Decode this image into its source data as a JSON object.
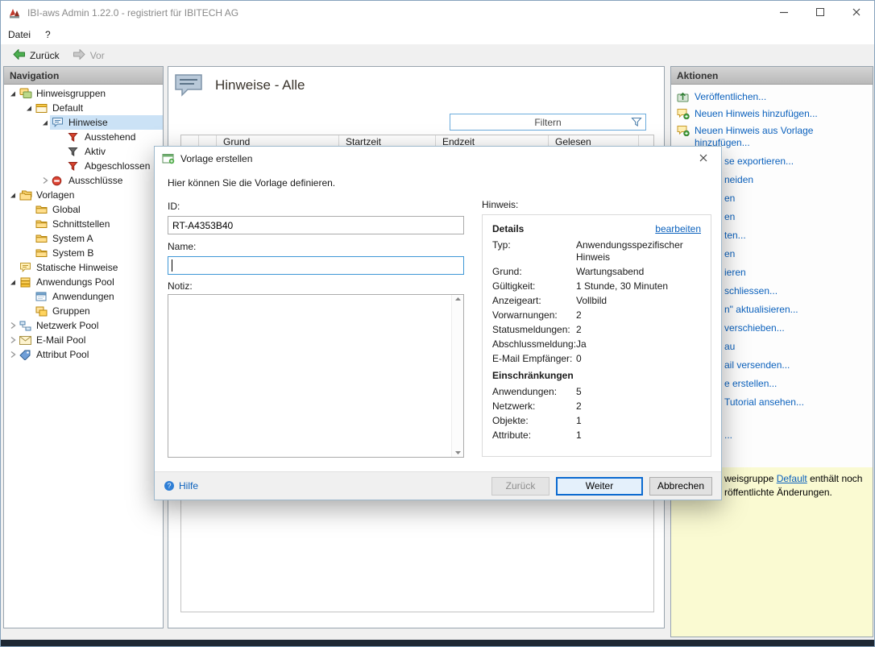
{
  "window": {
    "title": "IBI-aws Admin 1.22.0 - registriert für IBITECH AG"
  },
  "menubar": {
    "items": [
      {
        "label": "Datei"
      },
      {
        "label": "?"
      }
    ]
  },
  "toolbar": {
    "back": "Zurück",
    "forward": "Vor"
  },
  "nav": {
    "header": "Navigation",
    "items": [
      {
        "label": "Hinweisgruppen",
        "level": 0,
        "chevron": "expanded",
        "icon": "group-stack"
      },
      {
        "label": "Default",
        "level": 1,
        "chevron": "expanded",
        "icon": "hint-group"
      },
      {
        "label": "Hinweise",
        "level": 2,
        "chevron": "expanded",
        "icon": "bubble-blue",
        "selected": true
      },
      {
        "label": "Ausstehend",
        "level": 3,
        "chevron": null,
        "icon": "funnel-red"
      },
      {
        "label": "Aktiv",
        "level": 3,
        "chevron": null,
        "icon": "funnel-dark"
      },
      {
        "label": "Abgeschlossen",
        "level": 3,
        "chevron": null,
        "icon": "funnel-red"
      },
      {
        "label": "Ausschlüsse",
        "level": 2,
        "chevron": "collapsed",
        "icon": "no-entry"
      },
      {
        "label": "Vorlagen",
        "level": 0,
        "chevron": "expanded",
        "icon": "folder-stack"
      },
      {
        "label": "Global",
        "level": 1,
        "chevron": null,
        "icon": "folder"
      },
      {
        "label": "Schnittstellen",
        "level": 1,
        "chevron": null,
        "icon": "folder"
      },
      {
        "label": "System A",
        "level": 1,
        "chevron": null,
        "icon": "folder"
      },
      {
        "label": "System B",
        "level": 1,
        "chevron": null,
        "icon": "folder"
      },
      {
        "label": "Statische Hinweise",
        "level": 0,
        "chevron": null,
        "icon": "bubble-yellow"
      },
      {
        "label": "Anwendungs Pool",
        "level": 0,
        "chevron": "expanded",
        "icon": "pool"
      },
      {
        "label": "Anwendungen",
        "level": 1,
        "chevron": null,
        "icon": "window-blue"
      },
      {
        "label": "Gruppen",
        "level": 1,
        "chevron": null,
        "icon": "group"
      },
      {
        "label": "Netzwerk Pool",
        "level": 0,
        "chevron": "collapsed",
        "icon": "network"
      },
      {
        "label": "E-Mail Pool",
        "level": 0,
        "chevron": "collapsed",
        "icon": "mail"
      },
      {
        "label": "Attribut Pool",
        "level": 0,
        "chevron": "collapsed",
        "icon": "tag"
      }
    ]
  },
  "main": {
    "title": "Hinweise - Alle",
    "filter": {
      "placeholder": "Filtern"
    },
    "table": {
      "columns": [
        "",
        "",
        "Grund",
        "Startzeit",
        "Endzeit",
        "Gelesen"
      ]
    }
  },
  "actions": {
    "header": "Aktionen",
    "items": [
      {
        "label": "Veröffentlichen...",
        "icon": "publish",
        "obscured": false
      },
      {
        "label": "Neuen Hinweis hinzufügen...",
        "icon": "add-hint",
        "obscured": false
      },
      {
        "label": "Neuen Hinweis aus Vorlage hinzufügen...",
        "icon": "add-hint",
        "obscured": false
      },
      {
        "label": "se exportieren...",
        "obscured": true
      },
      {
        "label": "neiden",
        "obscured": true
      },
      {
        "label": "en",
        "obscured": true
      },
      {
        "label": "en",
        "obscured": true
      },
      {
        "label": "ten...",
        "obscured": true
      },
      {
        "label": "en",
        "obscured": true
      },
      {
        "label": "ieren",
        "obscured": true
      },
      {
        "label": "schliessen...",
        "obscured": true
      },
      {
        "label": "n\" aktualisieren...",
        "obscured": true
      },
      {
        "label": "verschieben...",
        "obscured": true
      },
      {
        "label": "au",
        "obscured": true
      },
      {
        "label": "ail versenden...",
        "obscured": true
      },
      {
        "label": "e erstellen...",
        "obscured": true
      },
      {
        "label": "Tutorial ansehen...",
        "obscured": true
      },
      {
        "label": "...",
        "obscured": true
      }
    ]
  },
  "notice": {
    "line1_pre": "weisgruppe ",
    "line1_link": "Default",
    "line1_post": " enthält noch",
    "line2": "röffentlichte Änderungen."
  },
  "dialog": {
    "title": "Vorlage erstellen",
    "description": "Hier können Sie die Vorlage definieren.",
    "fields": {
      "id_label": "ID:",
      "id_value": "RT-A4353B40",
      "name_label": "Name:",
      "name_value": "",
      "note_label": "Notiz:",
      "note_value": ""
    },
    "hinweis_label": "Hinweis:",
    "details": {
      "heading": "Details",
      "edit_link": "bearbeiten",
      "rows": [
        {
          "label": "Typ:",
          "value": "Anwendungsspezifischer Hinweis"
        },
        {
          "label": "Grund:",
          "value": "Wartungsabend"
        },
        {
          "label": "Gültigkeit:",
          "value": "1 Stunde, 30 Minuten"
        },
        {
          "label": "Anzeigeart:",
          "value": "Vollbild"
        },
        {
          "label": "Vorwarnungen:",
          "value": "2"
        },
        {
          "label": "Statusmeldungen:",
          "value": "2"
        },
        {
          "label": "Abschlussmeldung:",
          "value": "Ja"
        },
        {
          "label": "E-Mail Empfänger:",
          "value": "0"
        }
      ],
      "heading2": "Einschränkungen",
      "rows2": [
        {
          "label": "Anwendungen:",
          "value": "5"
        },
        {
          "label": "Netzwerk:",
          "value": "2"
        },
        {
          "label": "Objekte:",
          "value": "1"
        },
        {
          "label": "Attribute:",
          "value": "1"
        }
      ]
    },
    "footer": {
      "help": "Hilfe",
      "back": "Zurück",
      "next": "Weiter",
      "cancel": "Abbrechen"
    }
  }
}
